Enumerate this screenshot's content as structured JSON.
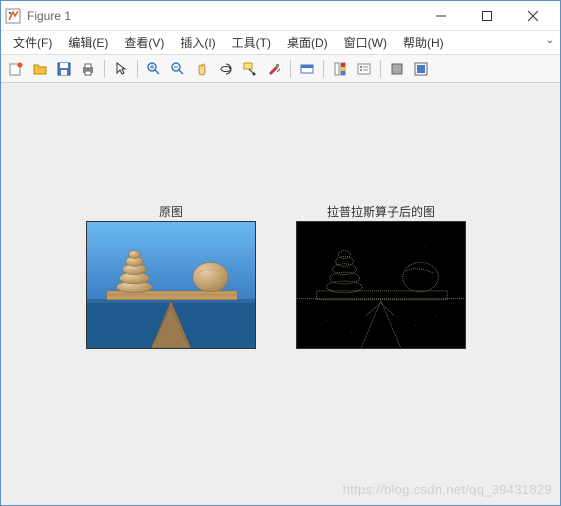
{
  "window": {
    "title": "Figure 1"
  },
  "menu": {
    "file": "文件(F)",
    "edit": "编辑(E)",
    "view": "查看(V)",
    "insert": "插入(I)",
    "tools": "工具(T)",
    "desktop": "桌面(D)",
    "window": "窗口(W)",
    "help": "帮助(H)"
  },
  "subplot": {
    "left_title": "原图",
    "right_title": "拉普拉斯算子后的图"
  },
  "watermark": "https://blog.csdn.net/qq_39431829"
}
